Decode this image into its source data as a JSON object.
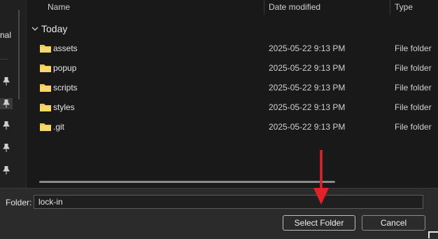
{
  "leftnav": {
    "partial_label": "nal",
    "pins": 5
  },
  "header": {
    "name": "Name",
    "date_modified": "Date modified",
    "type": "Type"
  },
  "group": {
    "label": "Today"
  },
  "rows": [
    {
      "name": "assets",
      "date": "2025-05-22 9:13 PM",
      "type": "File folder"
    },
    {
      "name": "popup",
      "date": "2025-05-22 9:13 PM",
      "type": "File folder"
    },
    {
      "name": "scripts",
      "date": "2025-05-22 9:13 PM",
      "type": "File folder"
    },
    {
      "name": "styles",
      "date": "2025-05-22 9:13 PM",
      "type": "File folder"
    },
    {
      "name": ".git",
      "date": "2025-05-22 9:13 PM",
      "type": "File folder"
    }
  ],
  "footer": {
    "folder_label": "Folder:",
    "folder_value": "lock-in",
    "select_label": "Select Folder",
    "cancel_label": "Cancel"
  },
  "colors": {
    "folder": "#f2c94c",
    "arrow": "#e3212b",
    "background": "#191919"
  }
}
